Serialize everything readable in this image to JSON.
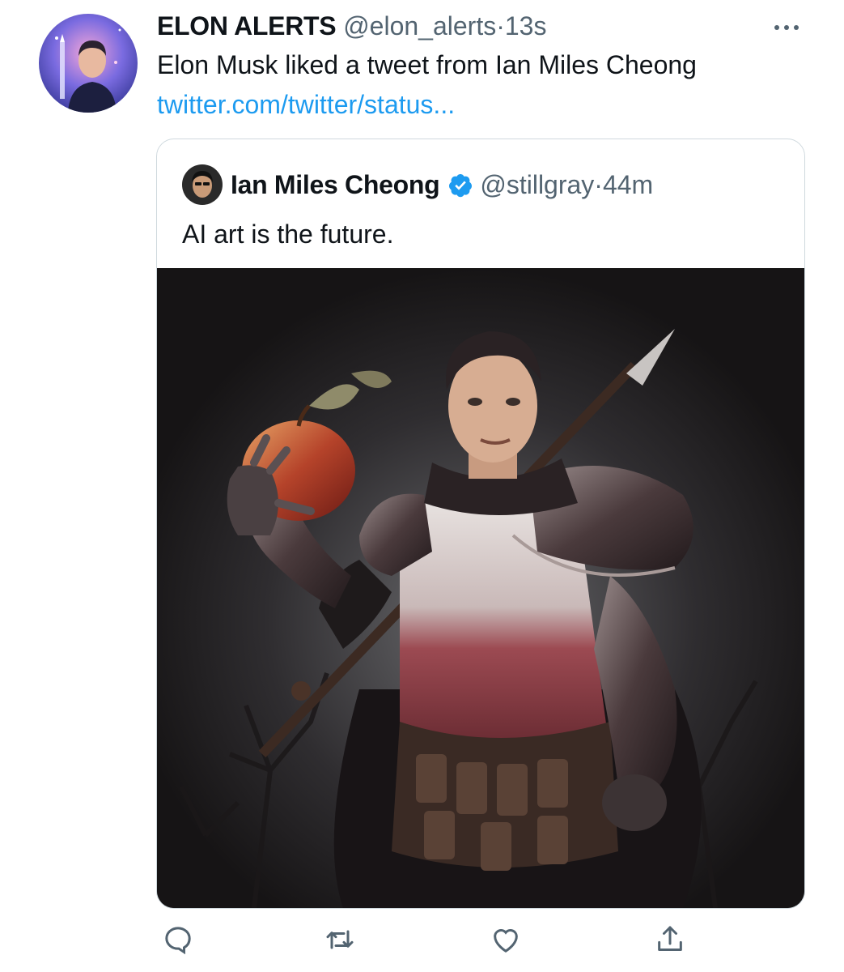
{
  "tweet": {
    "author_name": "ELON ALERTS",
    "author_handle": "@elon_alerts",
    "separator": "·",
    "time": "13s",
    "text": "Elon Musk liked a tweet from Ian Miles Cheong",
    "link": "twitter.com/twitter/status...",
    "more_icon": "more-dots-icon"
  },
  "quote": {
    "author_name": "Ian Miles Cheong",
    "verified_icon": "verified-badge-icon",
    "author_handle": "@stillgray",
    "separator": "·",
    "time": "44m",
    "text": "AI art is the future.",
    "media_alt": "AI-generated painting of a man in medieval armor holding a red apple and a spear"
  },
  "actions": [
    {
      "icon": "reply-icon"
    },
    {
      "icon": "retweet-icon"
    },
    {
      "icon": "like-icon"
    },
    {
      "icon": "share-icon"
    }
  ],
  "colors": {
    "link": "#1d9bf0",
    "secondary_text": "#536471",
    "verified": "#1d9bf0",
    "border": "#cfd9de"
  }
}
